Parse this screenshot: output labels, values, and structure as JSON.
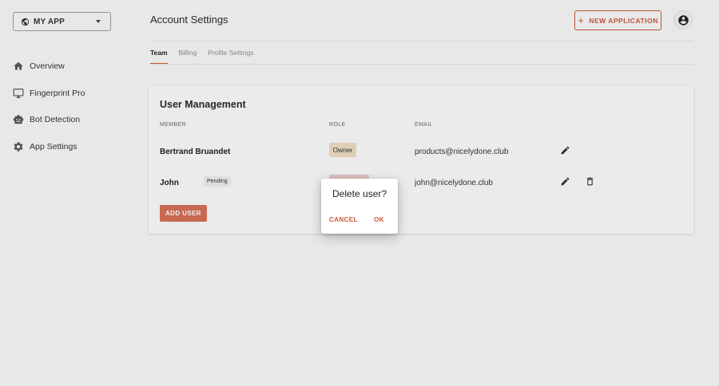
{
  "sidebar": {
    "app_switcher": {
      "label": "MY APP",
      "icon": "globe-icon"
    },
    "items": [
      {
        "label": "Overview",
        "icon": "home-icon"
      },
      {
        "label": "Fingerprint Pro",
        "icon": "monitor-icon"
      },
      {
        "label": "Bot Detection",
        "icon": "robot-icon"
      },
      {
        "label": "App Settings",
        "icon": "gear-icon"
      }
    ]
  },
  "header": {
    "title": "Account Settings",
    "new_app_label": "NEW APPLICATION",
    "account_icon": "account-circle-icon"
  },
  "tabs": [
    {
      "label": "Team",
      "active": true
    },
    {
      "label": "Billing",
      "active": false
    },
    {
      "label": "Profile Settings",
      "active": false
    }
  ],
  "user_management": {
    "title": "User Management",
    "columns": {
      "member": "MEMBER",
      "role": "ROLE",
      "email": "EMAIL"
    },
    "rows": [
      {
        "member": "Bertrand Bruandet",
        "badge": "",
        "role": "Owner",
        "email": "products@nicelydone.club"
      },
      {
        "member": "John",
        "badge": "Pending",
        "role": "",
        "email": "john@nicelydone.club"
      }
    ],
    "add_user_label": "ADD USER"
  },
  "dialog": {
    "title": "Delete user?",
    "cancel_label": "CANCEL",
    "ok_label": "OK"
  },
  "colors": {
    "accent": "#c9573a",
    "background": "#f3f3f3",
    "owner_badge": "#ead9c0",
    "role_badge_hidden": "#e8c8c8"
  }
}
